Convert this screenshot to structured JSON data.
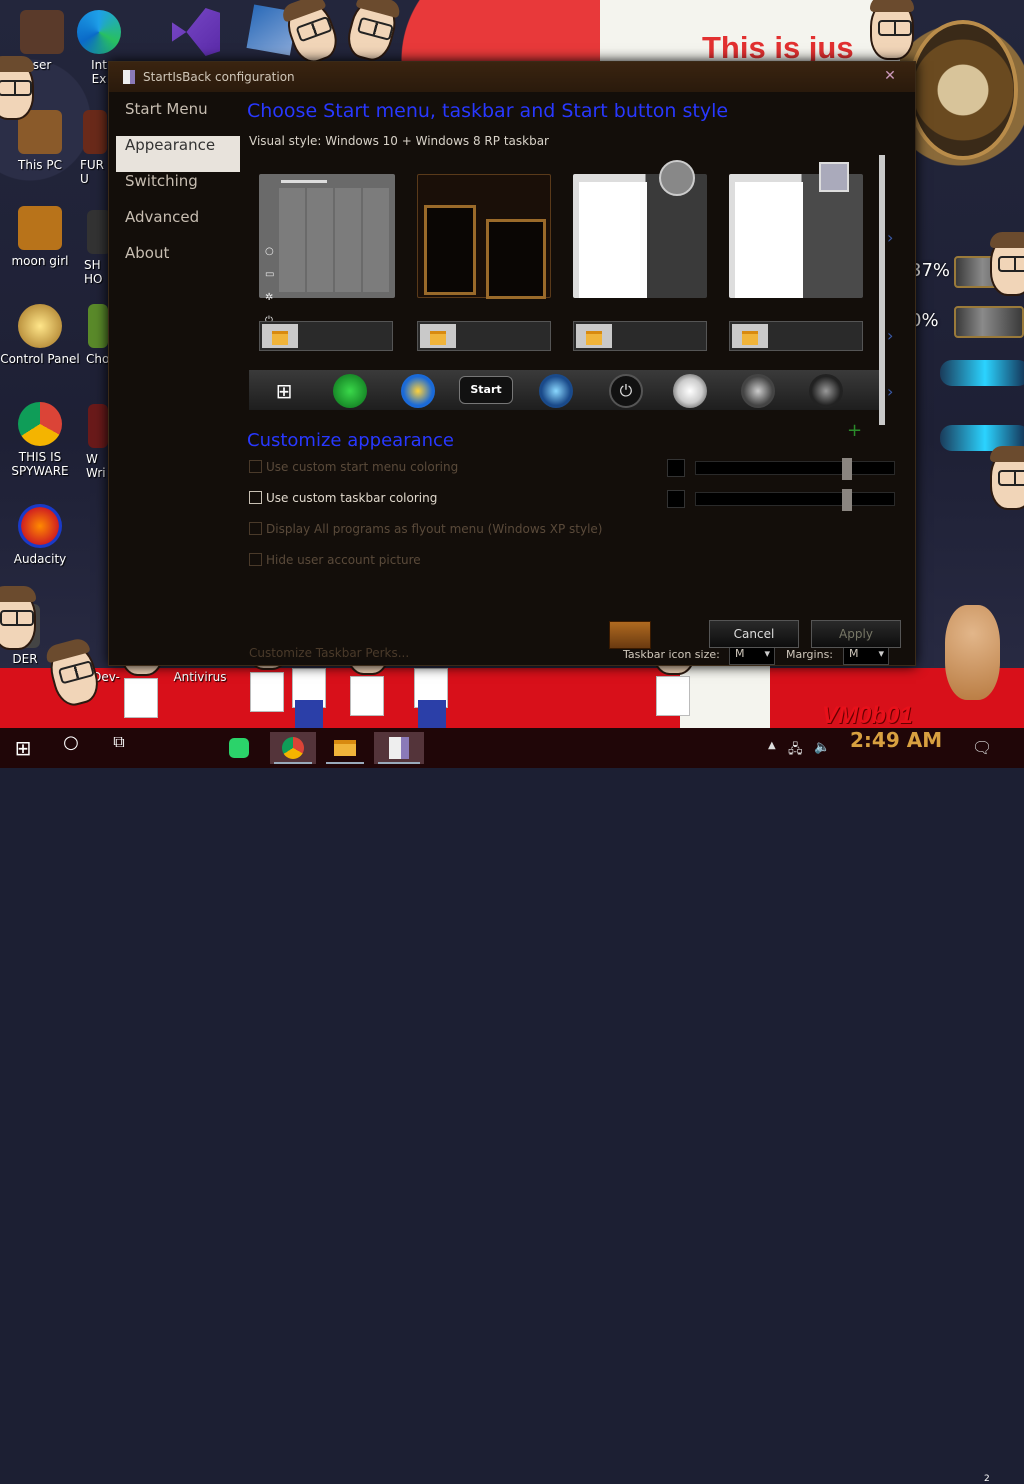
{
  "dialog": {
    "title": "StartIsBack configuration",
    "close": "✕",
    "nav": [
      "Start Menu",
      "Appearance",
      "Switching",
      "Advanced",
      "About"
    ],
    "selected_nav": "Appearance",
    "heading": "Choose Start menu, taskbar and Start button style",
    "visual_style": "Visual style:  Windows 10 + Windows 8 RP taskbar",
    "customize_heading": "Customize appearance",
    "plus": "+",
    "options": [
      {
        "label": "Use custom start menu coloring",
        "enabled": false
      },
      {
        "label": "Use custom taskbar coloring",
        "enabled": true
      },
      {
        "label": "Display All programs as flyout menu (Windows XP style)",
        "enabled": false
      },
      {
        "label": "Hide user account picture",
        "enabled": false
      }
    ],
    "perks": "Customize Taskbar Perks...",
    "icon_size_label": "Taskbar icon size:",
    "icon_size_value": "M",
    "margins_label": "Margins:",
    "margins_value": "M",
    "start_orb_label": "Start",
    "cancel": "Cancel",
    "apply": "Apply"
  },
  "desktop": {
    "icons": [
      {
        "label": "ser"
      },
      {
        "label": "Int\nEx"
      },
      {
        "label": "This PC"
      },
      {
        "label": "FUR\nU"
      },
      {
        "label": "moon girl"
      },
      {
        "label": "SH\nHO"
      },
      {
        "label": "Control Panel"
      },
      {
        "label": "Cho"
      },
      {
        "label": "THIS IS\nSPYWARE"
      },
      {
        "label": "W\nWri"
      },
      {
        "label": "Audacity"
      },
      {
        "label": "DER"
      },
      {
        "label": "Dev-"
      },
      {
        "label": "Antivirus"
      }
    ],
    "banner": "This is jus",
    "gauge1": "37%",
    "gauge2": "0%",
    "watermark": "VM0b01"
  },
  "taskbar": {
    "time": "2:49 AM",
    "notifications": "2",
    "tray_chevron": "▲"
  },
  "colors": {
    "heading": "#2838ff",
    "clock": "#d8a040",
    "taskbar": "#200608"
  }
}
